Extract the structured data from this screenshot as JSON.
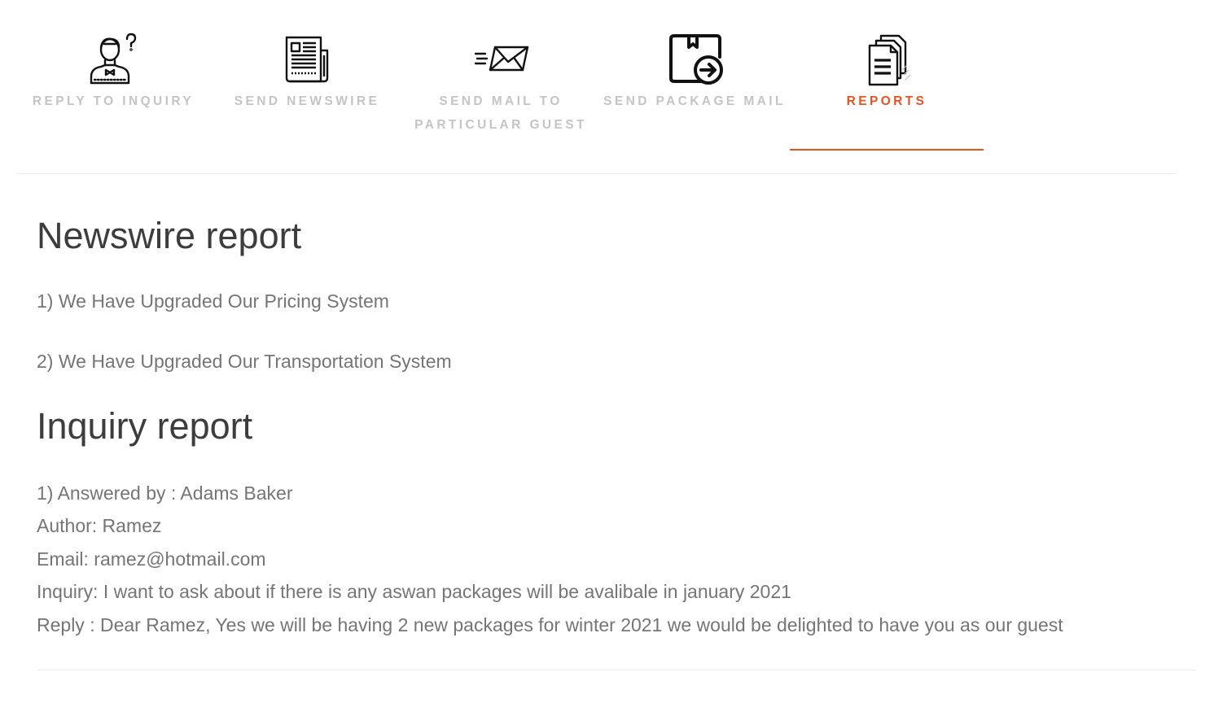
{
  "tabs": [
    {
      "label": "REPLY TO INQUIRY",
      "icon": "reception-agent-icon",
      "active": false
    },
    {
      "label": "SEND NEWSWIRE",
      "icon": "newspaper-icon",
      "active": false
    },
    {
      "label": "SEND MAIL TO",
      "label2": "PARTICULAR GUEST",
      "icon": "sending-mail-icon",
      "active": false
    },
    {
      "label": "SEND PACKAGE MAIL",
      "icon": "package-forward-icon",
      "active": false
    },
    {
      "label": "REPORTS",
      "icon": "documents-icon",
      "active": true
    }
  ],
  "colors": {
    "accent": "#e8521f",
    "tab_inactive": "#c4c4c4",
    "heading": "#3d3d3d",
    "body_text": "#757575"
  },
  "newswire": {
    "title": "Newswire report",
    "items": [
      "1) We Have Upgraded Our Pricing System",
      "2) We Have Upgraded Our Transportation System"
    ]
  },
  "inquiry": {
    "title": "Inquiry report",
    "entries": [
      {
        "answered_by": "1) Answered by : Adams Baker",
        "author": "Author: Ramez",
        "email": "Email: ramez@hotmail.com",
        "inquiry": "Inquiry: I want to ask about if there is any aswan packages will be avalibale in january 2021",
        "reply": "Reply : Dear Ramez, Yes we will be having 2 new packages for winter 2021 we would be delighted to have you as our guest"
      }
    ]
  }
}
